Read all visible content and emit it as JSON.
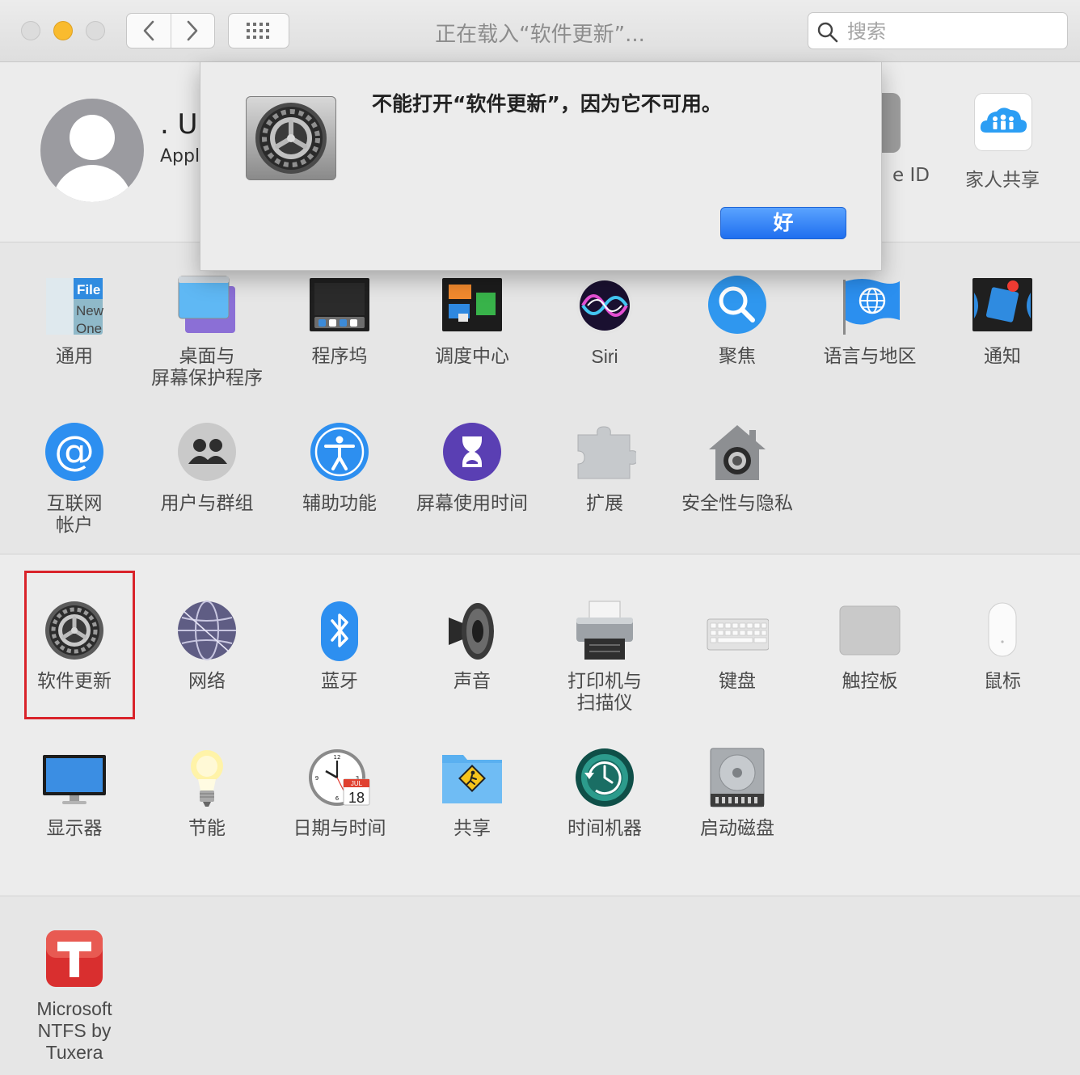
{
  "window": {
    "title": "正在载入“软件更新”..."
  },
  "toolbar": {
    "search_placeholder": "搜索"
  },
  "account": {
    "name_partial": ". Ur",
    "subtitle_partial": "Apple",
    "apple_id_label": "e ID",
    "family_label": "家人共享"
  },
  "alert": {
    "message": "不能打开“软件更新”，因为它不可用。",
    "ok_label": "好"
  },
  "section1": {
    "general": "通用",
    "desktop": "桌面与\n屏幕保护程序",
    "dock": "程序坞",
    "mission": "调度中心",
    "siri": "Siri",
    "spotlight": "聚焦",
    "language": "语言与地区",
    "notifications": "通知",
    "internet": "互联网\n帐户",
    "users": "用户与群组",
    "accessibility": "辅助功能",
    "screentime": "屏幕使用时间",
    "extensions": "扩展",
    "security": "安全性与隐私"
  },
  "section2": {
    "software_update": "软件更新",
    "network": "网络",
    "bluetooth": "蓝牙",
    "sound": "声音",
    "printers": "打印机与\n扫描仪",
    "keyboard": "键盘",
    "trackpad": "触控板",
    "mouse": "鼠标",
    "displays": "显示器",
    "energy": "节能",
    "datetime": "日期与时间",
    "sharing": "共享",
    "timemachine": "时间机器",
    "startup": "启动磁盘"
  },
  "section3": {
    "ntfs": "Microsoft\nNTFS by Tuxera"
  },
  "icon_text": {
    "general_file": "File",
    "general_new": "New",
    "general_one": "One",
    "calendar_month": "JUL",
    "calendar_day": "18"
  },
  "colors": {
    "ok_button": "#1f6fef",
    "highlight_border": "#d9232a",
    "minimize_light": "#f9bb2e"
  }
}
